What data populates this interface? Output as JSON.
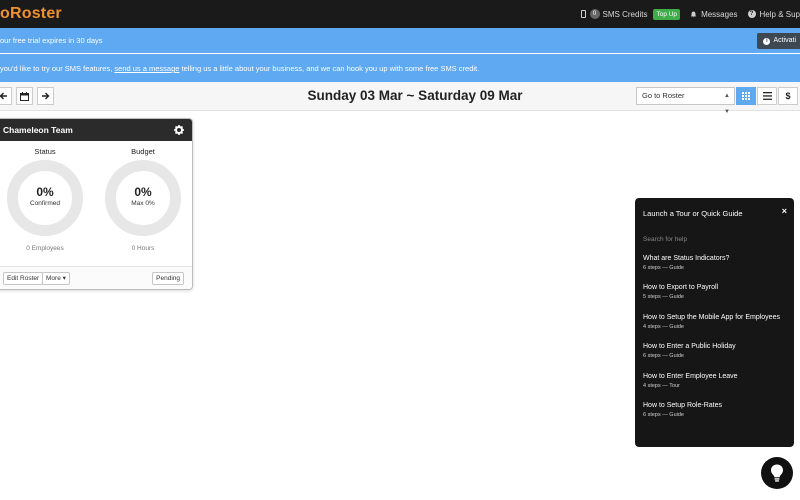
{
  "app": {
    "logo_text": "oRoster"
  },
  "nav": {
    "sms_credits_count": "0",
    "sms_credits_label": "SMS Credits",
    "top_up_label": "Top Up",
    "messages_label": "Messages",
    "help_label": "Help & Sup"
  },
  "trial_banner": {
    "text": "our free trial expires in 30 days",
    "activate_label": "Activati"
  },
  "sms_banner": {
    "text_before": "you'd like to try our SMS features, ",
    "link_text": "send us a message",
    "text_after": " telling us a little about your business, and we can hook you up with some free SMS credit."
  },
  "toolbar": {
    "date_range": "Sunday 03 Mar ~ Saturday 09 Mar",
    "goto_value": "Go to Roster",
    "currency_symbol": "$",
    "active_view": "grid"
  },
  "team_card": {
    "name": "Chameleon Team",
    "status": {
      "title": "Status",
      "percent": "0%",
      "sublabel": "Confirmed",
      "footer": "0 Employees",
      "fill": 0
    },
    "budget": {
      "title": "Budget",
      "percent": "0%",
      "sublabel": "Max 0%",
      "footer": "0 Hours",
      "fill": 0
    },
    "edit_label": "Edit Roster",
    "more_label": "More ▾",
    "pending_label": "Pending"
  },
  "help_panel": {
    "title": "Launch a Tour or Quick Guide",
    "close_symbol": "×",
    "search_placeholder": "Search for help",
    "guides": [
      {
        "title": "What are Status Indicators?",
        "meta": "6 steps — Guide"
      },
      {
        "title": "How to Export to Payroll",
        "meta": "5 steps — Guide"
      },
      {
        "title": "How to Setup the Mobile App for Employees",
        "meta": "4 steps — Guide"
      },
      {
        "title": "How to Enter a Public Holiday",
        "meta": "6 steps — Guide"
      },
      {
        "title": "How to Enter Employee Leave",
        "meta": "4 steps — Tour"
      },
      {
        "title": "How to Setup Role-Rates",
        "meta": "6 steps — Guide"
      }
    ]
  },
  "colors": {
    "brand_orange": "#f0912f",
    "banner_blue": "#5fa8f2",
    "nav_dark": "#1a1a1a",
    "top_up_green": "#3fae49",
    "ring_grey": "#e7e7e7"
  },
  "icons": [
    "phone-icon",
    "bell-icon",
    "help-circle-icon",
    "info-icon",
    "arrow-left-icon",
    "calendar-icon",
    "arrow-right-icon",
    "grid-view-icon",
    "list-view-icon",
    "gear-icon",
    "close-icon",
    "lightbulb-icon"
  ]
}
